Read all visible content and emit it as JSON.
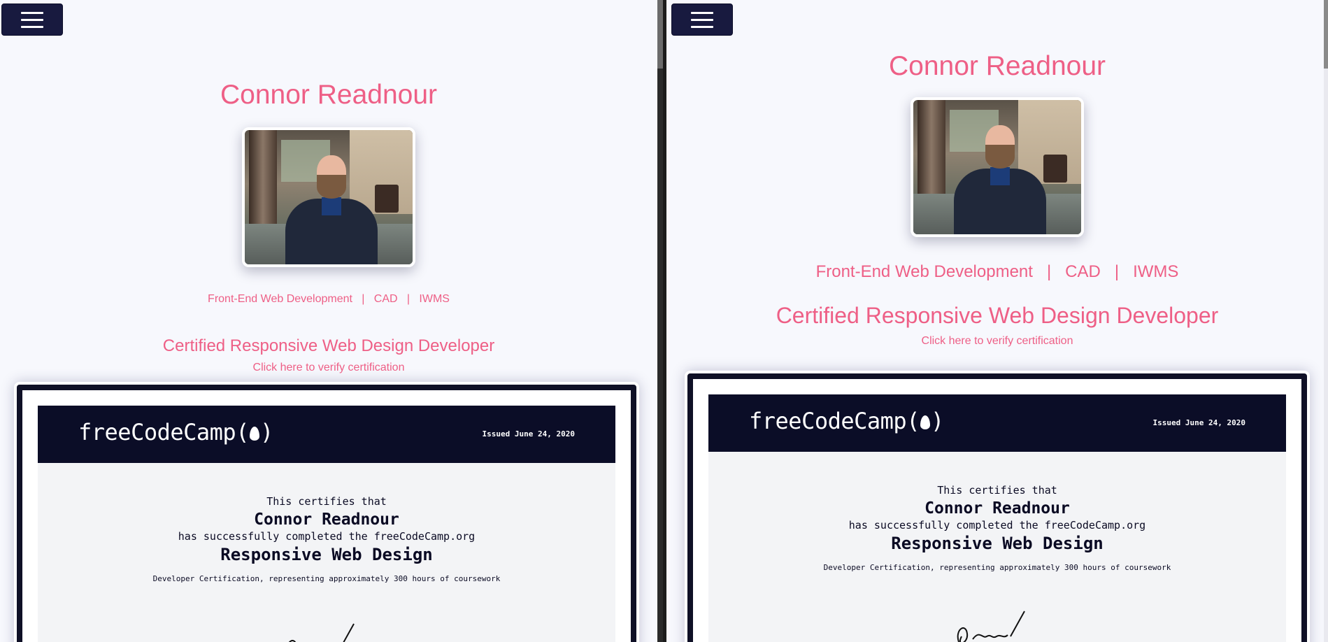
{
  "menu": {
    "label": "Toggle navigation"
  },
  "profile": {
    "name": "Connor Readnour",
    "skills": "Front-End Web Development   |   CAD   |   IWMS",
    "cert_title": "Certified Responsive Web Design Developer",
    "verify_link": "Click here to verify certification"
  },
  "certificate": {
    "logo_text": "freeCodeCamp(",
    "logo_close": ")",
    "issued_label": "Issued",
    "issued_date": "June 24, 2020",
    "line1": "This certifies that",
    "recipient": "Connor Readnour",
    "line2": "has successfully completed the freeCodeCamp.org",
    "course": "Responsive Web Design",
    "line3": "Developer Certification, representing approximately 300 hours of coursework"
  },
  "colors": {
    "accent": "#ee5f86",
    "navy": "#0b0d27",
    "menu": "#181a3f"
  }
}
